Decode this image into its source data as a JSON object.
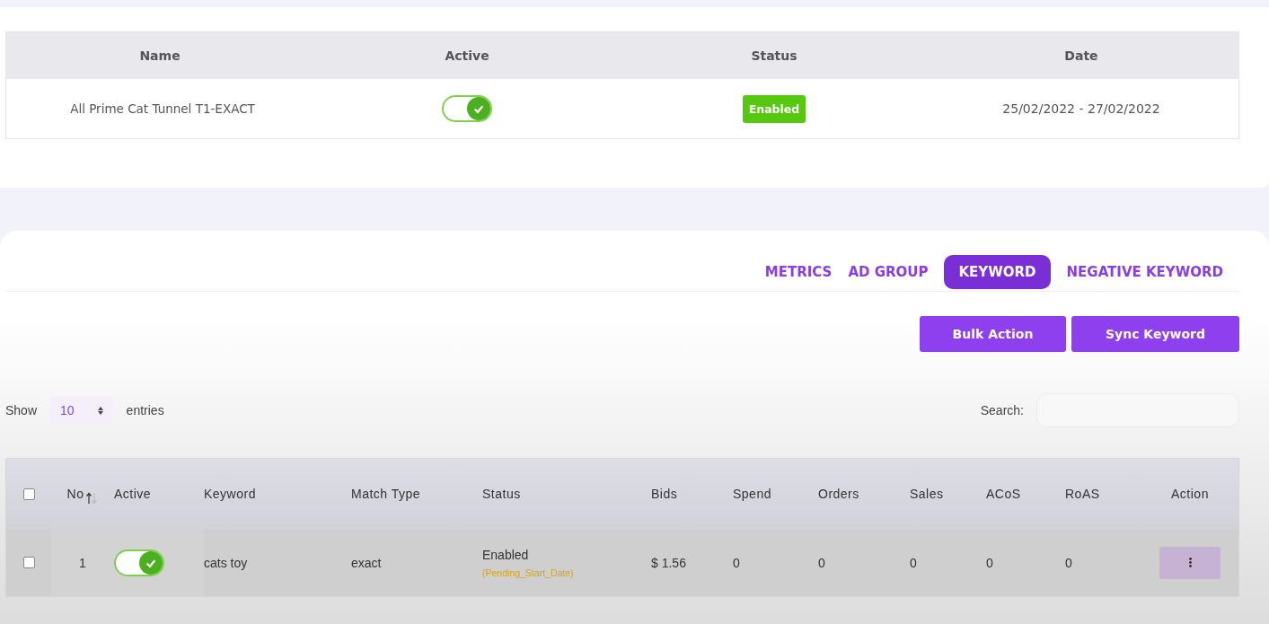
{
  "campaign_table": {
    "columns": [
      "Name",
      "Active",
      "Status",
      "Date"
    ],
    "rows": [
      {
        "name": "All Prime Cat Tunnel T1-EXACT",
        "active": true,
        "status": "Enabled",
        "date": "25/02/2022 - 27/02/2022"
      }
    ]
  },
  "tabs": [
    {
      "label": "METRICS",
      "selected": false
    },
    {
      "label": "AD GROUP",
      "selected": false
    },
    {
      "label": "KEYWORD",
      "selected": true
    },
    {
      "label": "NEGATIVE KEYWORD",
      "selected": false
    }
  ],
  "buttons": [
    "Bulk Action",
    "Sync Keyword"
  ],
  "length_control": {
    "show_label": "Show",
    "value": "10",
    "entries_label": "entries"
  },
  "search": {
    "label": "Search:"
  },
  "keyword_table": {
    "header_checked": false,
    "columns": [
      "No",
      "Active",
      "Keyword",
      "Match Type",
      "Status",
      "Bids",
      "Spend",
      "Orders",
      "Sales",
      "ACoS",
      "RoAS",
      "Action"
    ],
    "rows": [
      {
        "checked": false,
        "no": "1",
        "active": true,
        "keyword": "cats toy",
        "match_type": "exact",
        "status": "Enabled",
        "status_note": "(Pending_Start_Date)",
        "bids": "$ 1.56",
        "spend": "0",
        "orders": "0",
        "sales": "0",
        "acos": "0",
        "roas": "0"
      }
    ]
  }
}
